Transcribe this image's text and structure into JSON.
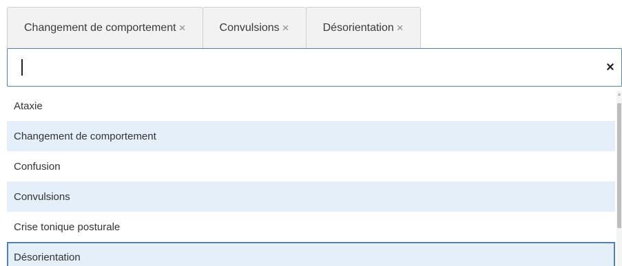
{
  "selected_tags": [
    {
      "label": "Changement de comportement",
      "remove_icon": "×"
    },
    {
      "label": "Convulsions",
      "remove_icon": "×"
    },
    {
      "label": "Désorientation",
      "remove_icon": "×"
    }
  ],
  "search": {
    "value": "",
    "placeholder": "",
    "clear_icon": "×"
  },
  "options": [
    {
      "label": "Ataxie",
      "state": "normal"
    },
    {
      "label": "Changement de comportement",
      "state": "selected"
    },
    {
      "label": "Confusion",
      "state": "normal"
    },
    {
      "label": "Convulsions",
      "state": "selected"
    },
    {
      "label": "Crise tonique posturale",
      "state": "normal"
    },
    {
      "label": "Désorientation",
      "state": "highlighted"
    }
  ],
  "scrollbar": {
    "up_arrow": "▲"
  },
  "colors": {
    "accent": "#4f7fb4",
    "selected_row_bg": "#e4eff9",
    "tag_bg": "#f2f2f2"
  }
}
